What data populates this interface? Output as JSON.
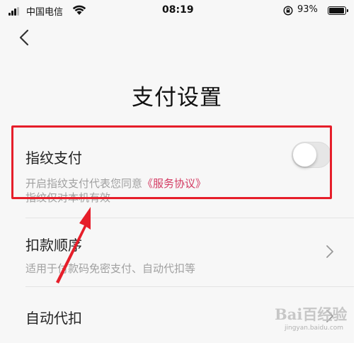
{
  "status_bar": {
    "carrier": "中国电信",
    "time": "08:19",
    "battery_percent": "93%",
    "battery_level": 0.93
  },
  "nav": {
    "back_icon": "chevron-left-icon"
  },
  "page": {
    "title": "支付设置"
  },
  "settings": {
    "fingerprint": {
      "label": "指纹支付",
      "desc_prefix": "开启指纹支付代表您同意",
      "desc_link": "《服务协议》",
      "desc_line2": "指纹仅对本机有效",
      "toggle_on": false
    },
    "payment_order": {
      "label": "扣款顺序",
      "desc": "适用于付款码免密支付、自动代扣等"
    },
    "auto_debit": {
      "label": "自动代扣"
    }
  },
  "annotations": {
    "highlight_color": "#e61e2a",
    "arrow_color": "#e61e2a"
  },
  "watermark": {
    "text": "Bai百经验",
    "sub": "jingyan.baidu.com"
  }
}
